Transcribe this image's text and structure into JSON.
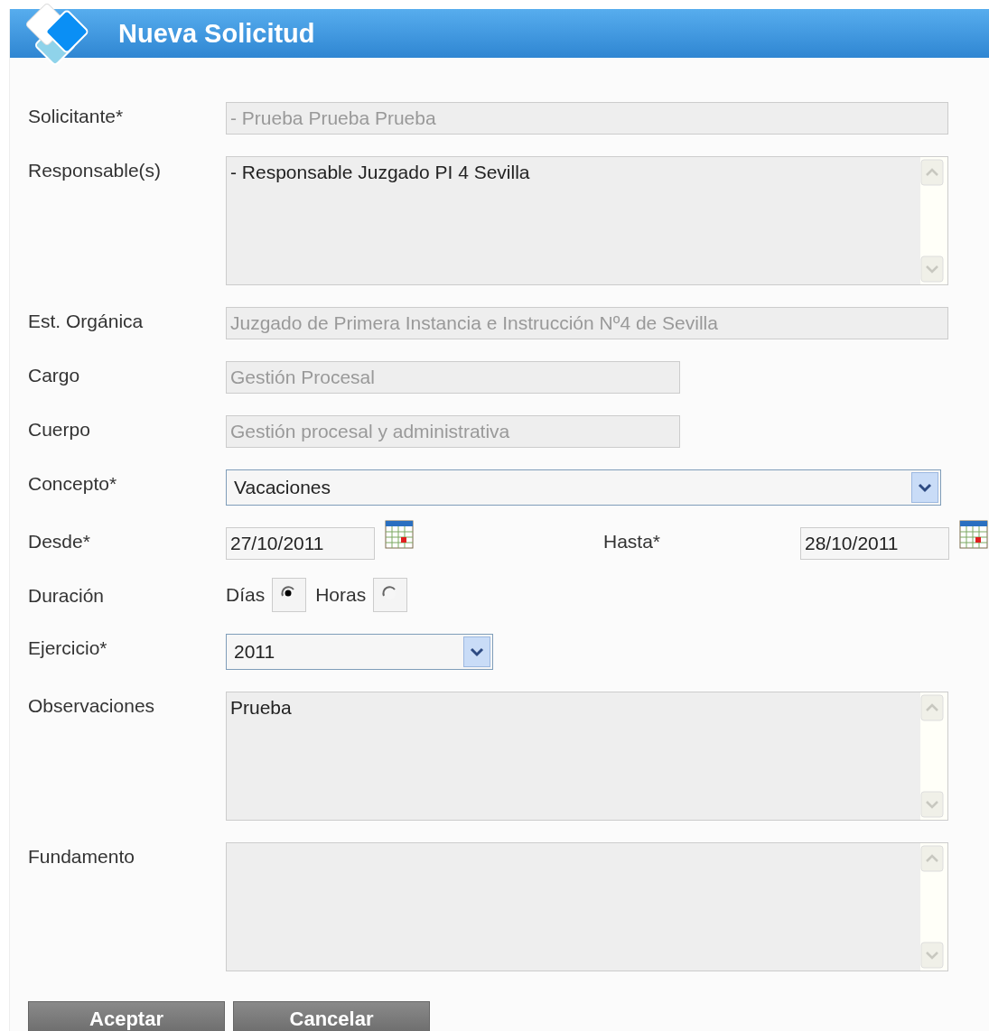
{
  "window": {
    "title": "Nueva Solicitud"
  },
  "fields": [
    {
      "kind": "text",
      "label": "Solicitante*",
      "value": "- Prueba Prueba Prueba",
      "disabled": true
    },
    {
      "kind": "textarea",
      "label": "Responsable(s)",
      "value": "- Responsable Juzgado PI 4 Sevilla"
    },
    {
      "kind": "text",
      "label": "Est. Orgánica",
      "value": "Juzgado de Primera Instancia e Instrucción Nº4 de Sevilla",
      "disabled": true
    },
    {
      "kind": "shorttext",
      "label": "Cargo",
      "value": "Gestión Procesal",
      "disabled": true
    },
    {
      "kind": "shorttext",
      "label": "Cuerpo",
      "value": "Gestión procesal y administrativa",
      "disabled": true
    },
    {
      "kind": "select",
      "label": "Concepto*",
      "value": "Vacaciones"
    },
    {
      "kind": "dates",
      "label": "Desde*",
      "value": "27/10/2011",
      "to_label": "Hasta*",
      "to_value": "28/10/2011"
    },
    {
      "kind": "radios",
      "label": "Duración",
      "options": [
        {
          "label": "Días",
          "selected": true
        },
        {
          "label": "Horas",
          "selected": false
        }
      ]
    },
    {
      "kind": "shortselect",
      "label": "Ejercicio*",
      "value": "2011"
    },
    {
      "kind": "textarea",
      "label": "Observaciones",
      "value": "Prueba"
    },
    {
      "kind": "textarea",
      "label": "Fundamento"
    }
  ],
  "buttons": [
    "Aceptar",
    "Cancelar"
  ]
}
